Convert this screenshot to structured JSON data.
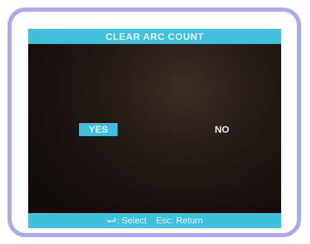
{
  "title": "CLEAR ARC COUNT",
  "options": {
    "yes_label": "YES",
    "no_label": "NO",
    "selected": "YES"
  },
  "footer": {
    "select_icon": "enter-icon",
    "select_label": ": Select",
    "return_key": "Esc",
    "return_label": ": Return"
  },
  "colors": {
    "bar": "#3fc1de",
    "screen": "#1a1311",
    "frame": "#a9a9ee"
  }
}
